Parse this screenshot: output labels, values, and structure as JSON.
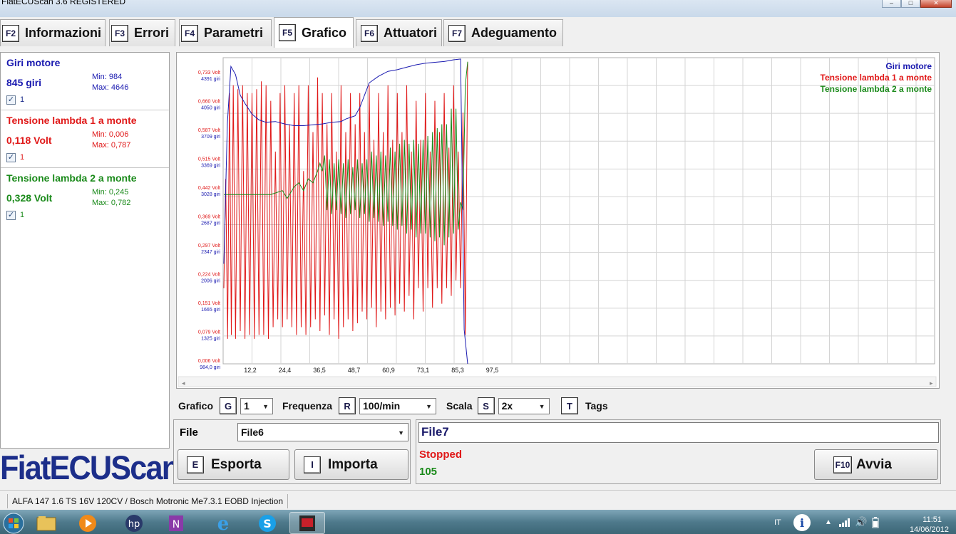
{
  "window": {
    "title": "FiatECUScan 3.6 REGISTERED"
  },
  "tabs": [
    {
      "key": "F2",
      "label": "Informazioni"
    },
    {
      "key": "F3",
      "label": "Errori"
    },
    {
      "key": "F4",
      "label": "Parametri"
    },
    {
      "key": "F5",
      "label": "Grafico"
    },
    {
      "key": "F6",
      "label": "Attuatori"
    },
    {
      "key": "F7",
      "label": "Adeguamento"
    }
  ],
  "params": [
    {
      "name": "Giri motore",
      "value": "845 giri",
      "min": "Min: 984",
      "max": "Max: 4646",
      "check": "1",
      "color": "#1a1ab0"
    },
    {
      "name": "Tensione lambda 1 a monte",
      "value": "0,118 Volt",
      "min": "Min: 0,006",
      "max": "Max: 0,787",
      "check": "1",
      "color": "#e01818"
    },
    {
      "name": "Tensione lambda 2 a monte",
      "value": "0,328 Volt",
      "min": "Min: 0,245",
      "max": "Max: 0,782",
      "check": "1",
      "color": "#1a8a1a"
    }
  ],
  "logo": "FiatECUScan",
  "chart_data": {
    "type": "line",
    "legend": [
      "Giri motore",
      "Tensione lambda 1 a monte",
      "Tensione lambda 2 a monte"
    ],
    "legend_position": "top-right",
    "x_ticks": [
      "12,2",
      "24,4",
      "36,5",
      "48,7",
      "60,9",
      "73,1",
      "85,3",
      "97,5"
    ],
    "y_ticks_volt": [
      "0,733 Volt",
      "0,660 Volt",
      "0,587 Volt",
      "0,515 Volt",
      "0,442 Volt",
      "0,369 Volt",
      "0,297 Volt",
      "0,224 Volt",
      "0,151 Volt",
      "0,079 Volt",
      "0,006 Volt"
    ],
    "y_ticks_rpm": [
      "4391 giri",
      "4050 giri",
      "3709 giri",
      "3369 giri",
      "3028 giri",
      "2687 giri",
      "2347 giri",
      "2006 giri",
      "1665 giri",
      "1325 giri",
      "984,0 giri"
    ],
    "grid": true,
    "series": [
      {
        "name": "Giri motore",
        "color": "#1a1ab0",
        "x": [
          0,
          1.5,
          3,
          5,
          7,
          9,
          12,
          15,
          18,
          22,
          26,
          30,
          34,
          38,
          42,
          46,
          50,
          52,
          54,
          56,
          58,
          60,
          62,
          66,
          70,
          74,
          78,
          82,
          86,
          90,
          94,
          98,
          101,
          102.5,
          104
        ],
        "y": [
          2200,
          3900,
          4600,
          4500,
          4250,
          4150,
          4020,
          3950,
          3920,
          3930,
          3900,
          3880,
          3880,
          3890,
          3900,
          3920,
          3930,
          3960,
          3980,
          4000,
          4100,
          4250,
          4400,
          4480,
          4540,
          4560,
          4590,
          4620,
          4640,
          4650,
          4660,
          4680,
          4690,
          1400,
          700
        ]
      },
      {
        "name": "Tensione lambda 1 a monte",
        "color": "#e01818",
        "x": [
          0,
          0.8,
          1.6,
          2.4,
          3.2,
          4,
          5,
          6,
          7,
          8,
          9,
          10,
          11,
          12,
          13,
          14,
          15,
          16,
          17,
          18,
          19,
          20,
          21,
          22,
          23,
          24,
          25,
          26,
          27,
          28,
          29,
          30,
          31,
          32,
          33,
          34,
          35,
          36,
          37,
          38,
          39,
          40,
          41,
          42,
          43,
          44,
          45,
          46,
          47,
          48,
          49,
          50,
          51,
          52,
          53,
          54,
          55,
          56,
          57,
          58,
          59,
          60,
          61,
          62,
          63,
          64,
          65,
          66,
          67,
          68,
          69,
          70,
          71,
          72,
          73,
          74,
          75,
          76,
          77,
          78,
          79,
          80,
          81,
          82,
          83,
          84,
          85,
          86,
          87,
          88,
          89,
          90,
          91,
          92,
          93,
          94,
          95,
          96,
          97,
          98,
          99,
          100,
          101,
          102,
          103,
          104
        ],
        "y": [
          0.2,
          0.48,
          0.07,
          0.7,
          0.08,
          0.72,
          0.07,
          0.71,
          0.09,
          0.72,
          0.07,
          0.7,
          0.08,
          0.7,
          0.07,
          0.71,
          0.08,
          0.73,
          0.08,
          0.72,
          0.07,
          0.68,
          0.1,
          0.55,
          0.12,
          0.7,
          0.1,
          0.72,
          0.12,
          0.62,
          0.1,
          0.7,
          0.08,
          0.72,
          0.1,
          0.5,
          0.08,
          0.72,
          0.1,
          0.6,
          0.12,
          0.74,
          0.09,
          0.7,
          0.13,
          0.62,
          0.08,
          0.7,
          0.12,
          0.55,
          0.07,
          0.72,
          0.1,
          0.6,
          0.12,
          0.7,
          0.09,
          0.62,
          0.11,
          0.7,
          0.14,
          0.6,
          0.12,
          0.72,
          0.15,
          0.58,
          0.1,
          0.7,
          0.14,
          0.6,
          0.12,
          0.72,
          0.15,
          0.58,
          0.13,
          0.7,
          0.16,
          0.6,
          0.14,
          0.72,
          0.18,
          0.55,
          0.12,
          0.68,
          0.2,
          0.58,
          0.14,
          0.7,
          0.2,
          0.55,
          0.15,
          0.68,
          0.2,
          0.6,
          0.16,
          0.7,
          0.2,
          0.56,
          0.18,
          0.72,
          0.22,
          0.55,
          0.2,
          0.65,
          0.08,
          0.78
        ]
      },
      {
        "name": "Tensione lambda 2 a monte",
        "color": "#1a8a1a",
        "x": [
          0,
          10,
          20,
          25,
          27,
          30,
          32,
          34,
          36,
          38,
          40,
          41,
          42,
          43,
          44,
          45,
          46,
          47,
          48,
          49,
          50,
          51,
          52,
          53,
          54,
          55,
          56,
          57,
          58,
          59,
          60,
          61,
          62,
          63,
          64,
          65,
          66,
          67,
          68,
          69,
          70,
          71,
          72,
          73,
          74,
          75,
          76,
          77,
          78,
          79,
          80,
          81,
          82,
          83,
          84,
          85,
          86,
          87,
          88,
          89,
          90,
          91,
          92,
          93,
          94,
          95,
          96,
          97,
          98,
          99,
          100,
          101,
          102,
          103,
          104
        ],
        "y": [
          0.44,
          0.44,
          0.44,
          0.45,
          0.43,
          0.46,
          0.47,
          0.45,
          0.48,
          0.47,
          0.5,
          0.52,
          0.5,
          0.54,
          0.4,
          0.53,
          0.39,
          0.52,
          0.4,
          0.53,
          0.39,
          0.52,
          0.38,
          0.53,
          0.39,
          0.51,
          0.4,
          0.53,
          0.38,
          0.52,
          0.39,
          0.53,
          0.37,
          0.55,
          0.38,
          0.54,
          0.37,
          0.55,
          0.36,
          0.54,
          0.37,
          0.56,
          0.36,
          0.55,
          0.35,
          0.57,
          0.36,
          0.58,
          0.34,
          0.57,
          0.35,
          0.58,
          0.33,
          0.57,
          0.34,
          0.58,
          0.34,
          0.59,
          0.33,
          0.6,
          0.32,
          0.61,
          0.33,
          0.62,
          0.31,
          0.62,
          0.33,
          0.66,
          0.34,
          0.66,
          0.35,
          0.42,
          0.4,
          0.72,
          0.78
        ]
      }
    ]
  },
  "controls": {
    "grafico_label": "Grafico",
    "grafico_key": "G",
    "grafico_value": "1",
    "frequenza_label": "Frequenza",
    "frequenza_key": "R",
    "frequenza_value": "100/min",
    "scala_label": "Scala",
    "scala_key": "S",
    "scala_value": "2x",
    "tags_key": "T",
    "tags_label": "Tags"
  },
  "file_panel": {
    "file_label": "File",
    "file_value": "File6",
    "export_key": "E",
    "export_label": "Esporta",
    "import_key": "I",
    "import_label": "Importa"
  },
  "status_panel": {
    "filename": "File7",
    "state": "Stopped",
    "count": "105",
    "start_key": "F10",
    "start_label": "Avvia"
  },
  "statusbar": {
    "vehicle": "ALFA 147 1.6 TS 16V 120CV / Bosch Motronic Me7.3.1 EOBD Injection"
  },
  "taskbar": {
    "lang": "IT",
    "time": "11:51",
    "date": "14/06/2012"
  }
}
